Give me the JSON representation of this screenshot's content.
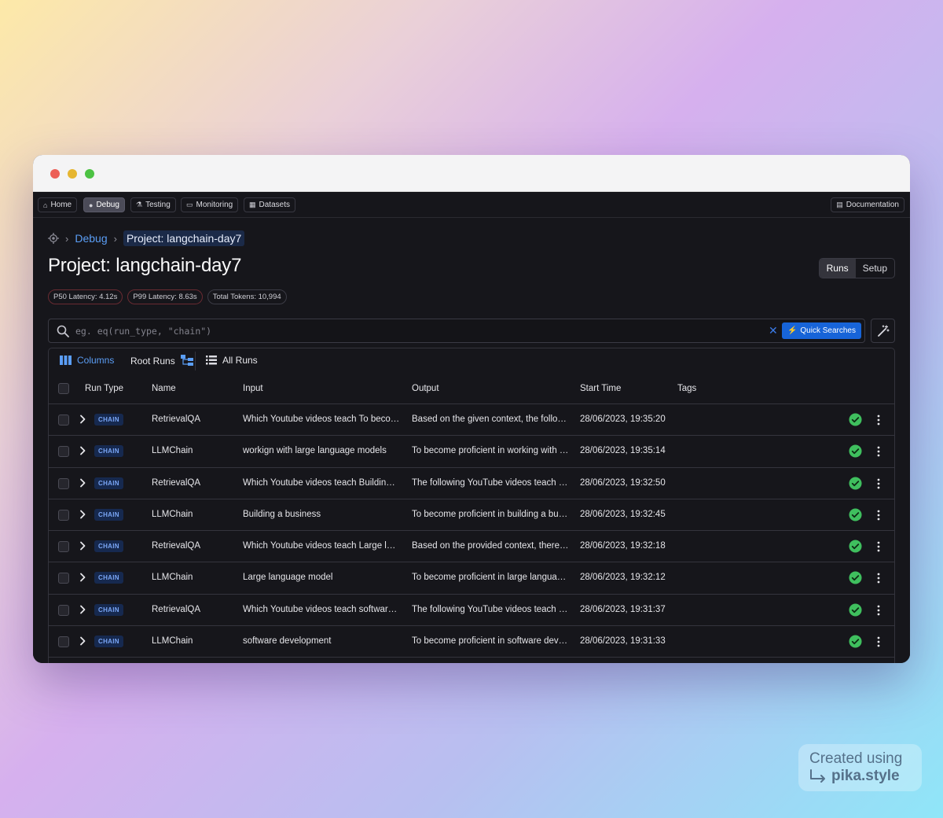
{
  "nav": {
    "home": "Home",
    "debug": "Debug",
    "testing": "Testing",
    "monitoring": "Monitoring",
    "datasets": "Datasets",
    "documentation": "Documentation"
  },
  "breadcrumb": {
    "debug": "Debug",
    "current": "Project: langchain-day7"
  },
  "page": {
    "title": "Project: langchain-day7",
    "tabs": [
      "Runs",
      "Setup"
    ]
  },
  "stats": {
    "p50": "P50 Latency: 4.12s",
    "p99": "P99 Latency: 8.63s",
    "tokens": "Total Tokens: 10,994"
  },
  "search": {
    "placeholder": "eg. eq(run_type, \"chain\")",
    "quick_label": "Quick Searches"
  },
  "toolbar": {
    "columns": "Columns",
    "root_runs": "Root Runs",
    "all_runs": "All Runs"
  },
  "table": {
    "headers": {
      "run_type": "Run Type",
      "name": "Name",
      "input": "Input",
      "output": "Output",
      "start_time": "Start Time",
      "tags": "Tags"
    },
    "rows": [
      {
        "type": "CHAIN",
        "name": "RetrievalQA",
        "input": "Which Youtube videos teach To beco…",
        "output": "Based on the given context, the follow…",
        "time": "28/06/2023, 19:35:20"
      },
      {
        "type": "CHAIN",
        "name": "LLMChain",
        "input": "workign with large language models",
        "output": "To become proficient in working with l…",
        "time": "28/06/2023, 19:35:14"
      },
      {
        "type": "CHAIN",
        "name": "RetrievalQA",
        "input": "Which Youtube videos teach Building …",
        "output": "The following YouTube videos teach a…",
        "time": "28/06/2023, 19:32:50"
      },
      {
        "type": "CHAIN",
        "name": "LLMChain",
        "input": "Building a business",
        "output": "To become proficient in building a bus…",
        "time": "28/06/2023, 19:32:45"
      },
      {
        "type": "CHAIN",
        "name": "RetrievalQA",
        "input": "Which Youtube videos teach Large la…",
        "output": "Based on the provided context, there i…",
        "time": "28/06/2023, 19:32:18"
      },
      {
        "type": "CHAIN",
        "name": "LLMChain",
        "input": "Large language model",
        "output": "To become proficient in large languag…",
        "time": "28/06/2023, 19:32:12"
      },
      {
        "type": "CHAIN",
        "name": "RetrievalQA",
        "input": "Which Youtube videos teach software …",
        "output": "The following YouTube videos teach s…",
        "time": "28/06/2023, 19:31:37"
      },
      {
        "type": "CHAIN",
        "name": "LLMChain",
        "input": "software development",
        "output": "To become proficient in software deve…",
        "time": "28/06/2023, 19:31:33"
      }
    ]
  },
  "watermark": {
    "line1": "Created using",
    "line2": "pika.style"
  },
  "colors": {
    "accent": "#5b9ef6",
    "primary_button": "#1764d8",
    "success": "#3fbf5e",
    "background": "#16161b"
  }
}
